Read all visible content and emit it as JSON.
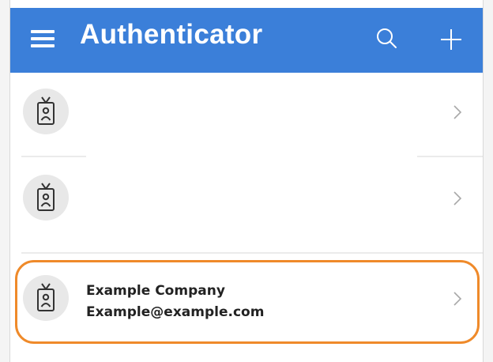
{
  "app": {
    "title": "Authenticator"
  },
  "icons": {
    "menu": "hamburger-menu-icon",
    "search": "search-icon",
    "add": "plus-icon",
    "account": "id-badge-icon",
    "row_arrow": "chevron-right-icon"
  },
  "colors": {
    "appbar": "#3b7fd9",
    "highlight": "#ef8a2a",
    "avatar_bg": "#e8e8e8"
  },
  "accounts": [
    {
      "name": "",
      "email": ""
    },
    {
      "name": "",
      "email": ""
    },
    {
      "name": "Example Company",
      "email": "Example@example.com"
    }
  ]
}
